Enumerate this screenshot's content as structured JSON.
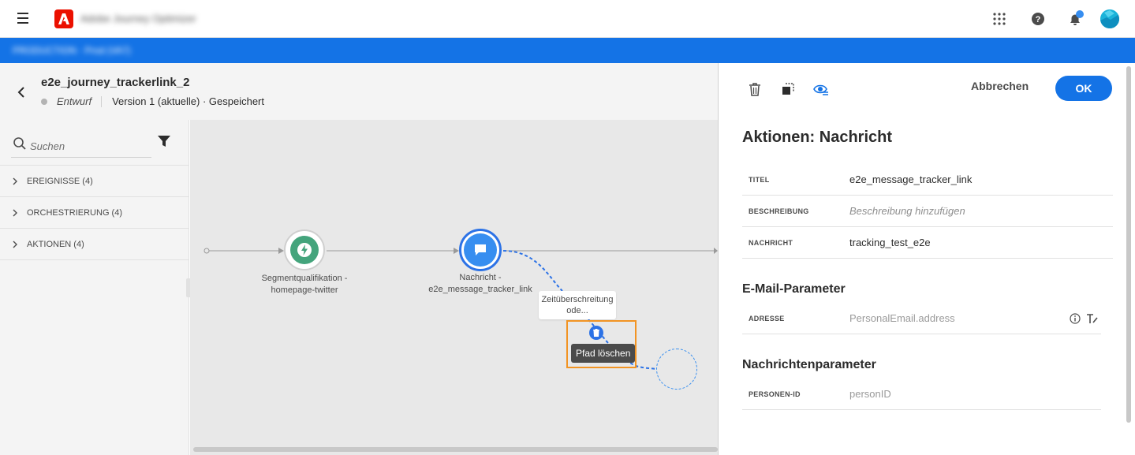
{
  "topbar": {
    "product_name": "Adobe Journey Optimizer",
    "menu_icon": "hamburger-icon",
    "logo_icon": "adobe-logo",
    "apps_icon": "apps-grid-icon",
    "help_icon": "help-icon",
    "notifications_icon": "bell-icon",
    "avatar_icon": "user-avatar"
  },
  "subbar": {
    "text": "PRODUCTION · Prod (VA7)"
  },
  "journey": {
    "title": "e2e_journey_trackerlink_2",
    "status": "Entwurf",
    "version": "Version 1 (aktuelle) · Gespeichert"
  },
  "left_panel": {
    "search_placeholder": "Suchen",
    "categories": [
      {
        "label": "EREIGNISSE (4)"
      },
      {
        "label": "ORCHESTRIERUNG (4)"
      },
      {
        "label": "AKTIONEN (4)"
      }
    ]
  },
  "canvas": {
    "segment_node": {
      "label": "Segmentqualifikation - homepage-twitter"
    },
    "message_node": {
      "label": "Nachricht - e2e_message_tracker_link"
    },
    "timeout_label": "Zeitüberschreitung ode...",
    "tooltip": "Pfad löschen"
  },
  "right_panel": {
    "cancel_label": "Abbrechen",
    "ok_label": "OK",
    "title": "Aktionen: Nachricht",
    "properties": [
      {
        "label": "TITEL",
        "value": "e2e_message_tracker_link"
      },
      {
        "label": "BESCHREIBUNG",
        "value": "Beschreibung hinzufügen"
      },
      {
        "label": "NACHRICHT",
        "value": "tracking_test_e2e"
      }
    ],
    "email_section": {
      "title": "E-Mail-Parameter",
      "label": "ADRESSE",
      "value": "PersonalEmail.address"
    },
    "message_section": {
      "title": "Nachrichtenparameter",
      "label": "PERSONEN-ID",
      "value": "personID"
    }
  },
  "colors": {
    "accent": "#1473e6",
    "segment_node": "#44a47c",
    "message_node": "#378ef0",
    "highlight": "#f29423",
    "adobe_red": "#eb1000"
  }
}
